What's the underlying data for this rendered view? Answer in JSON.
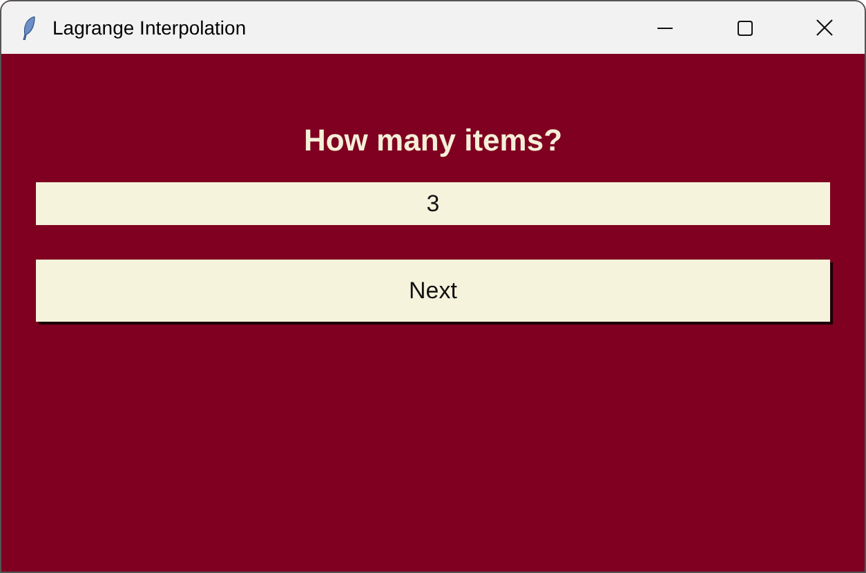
{
  "window": {
    "title": "Lagrange Interpolation"
  },
  "heading": "How many items?",
  "field": {
    "value": "3"
  },
  "buttons": [
    "Next"
  ]
}
